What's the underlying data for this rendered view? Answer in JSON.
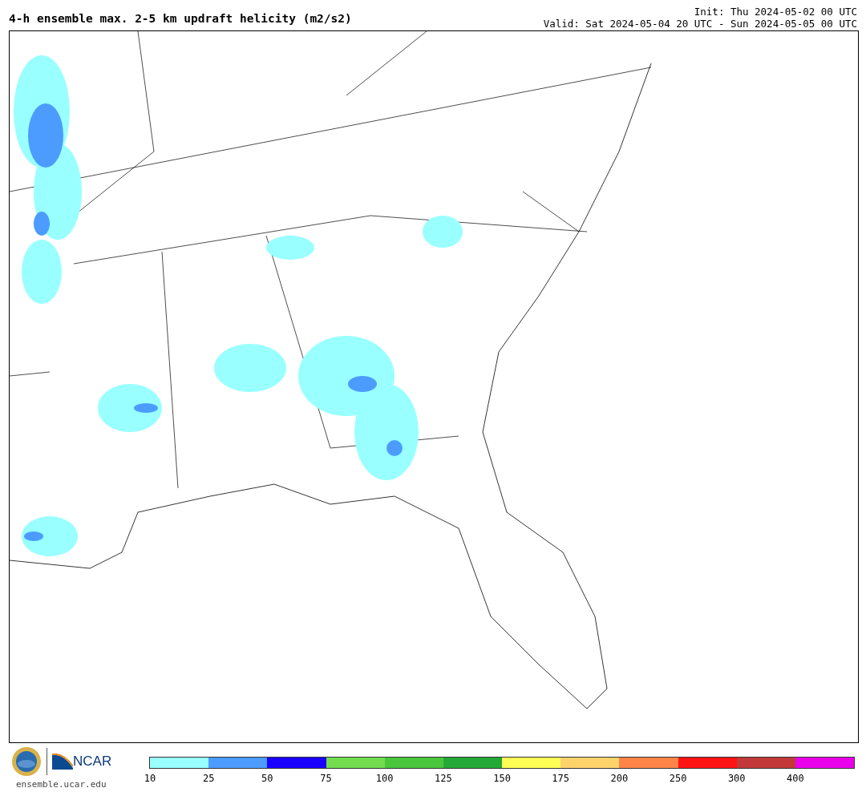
{
  "header": {
    "title": "4-h ensemble max. 2-5 km updraft helicity (m2/s2)",
    "init": "Init: Thu 2024-05-02 00 UTC",
    "valid": "Valid: Sat 2024-05-04 20 UTC - Sun 2024-05-05 00 UTC"
  },
  "footer": {
    "logo_text": "NCAR",
    "site": "ensemble.ucar.edu"
  },
  "colorbar": {
    "bins": [
      {
        "label": "10",
        "color": "#99ffff"
      },
      {
        "label": "25",
        "color": "#4c9cff"
      },
      {
        "label": "50",
        "color": "#1a00ff"
      },
      {
        "label": "75",
        "color": "#73dd4f"
      },
      {
        "label": "100",
        "color": "#49c63c"
      },
      {
        "label": "125",
        "color": "#24a938"
      },
      {
        "label": "150",
        "color": "#ffff55"
      },
      {
        "label": "175",
        "color": "#ffd36c"
      },
      {
        "label": "200",
        "color": "#ff8447"
      },
      {
        "label": "250",
        "color": "#ff1414"
      },
      {
        "label": "300",
        "color": "#c33838"
      },
      {
        "label": "400",
        "color": "#ea00ea"
      }
    ]
  }
}
